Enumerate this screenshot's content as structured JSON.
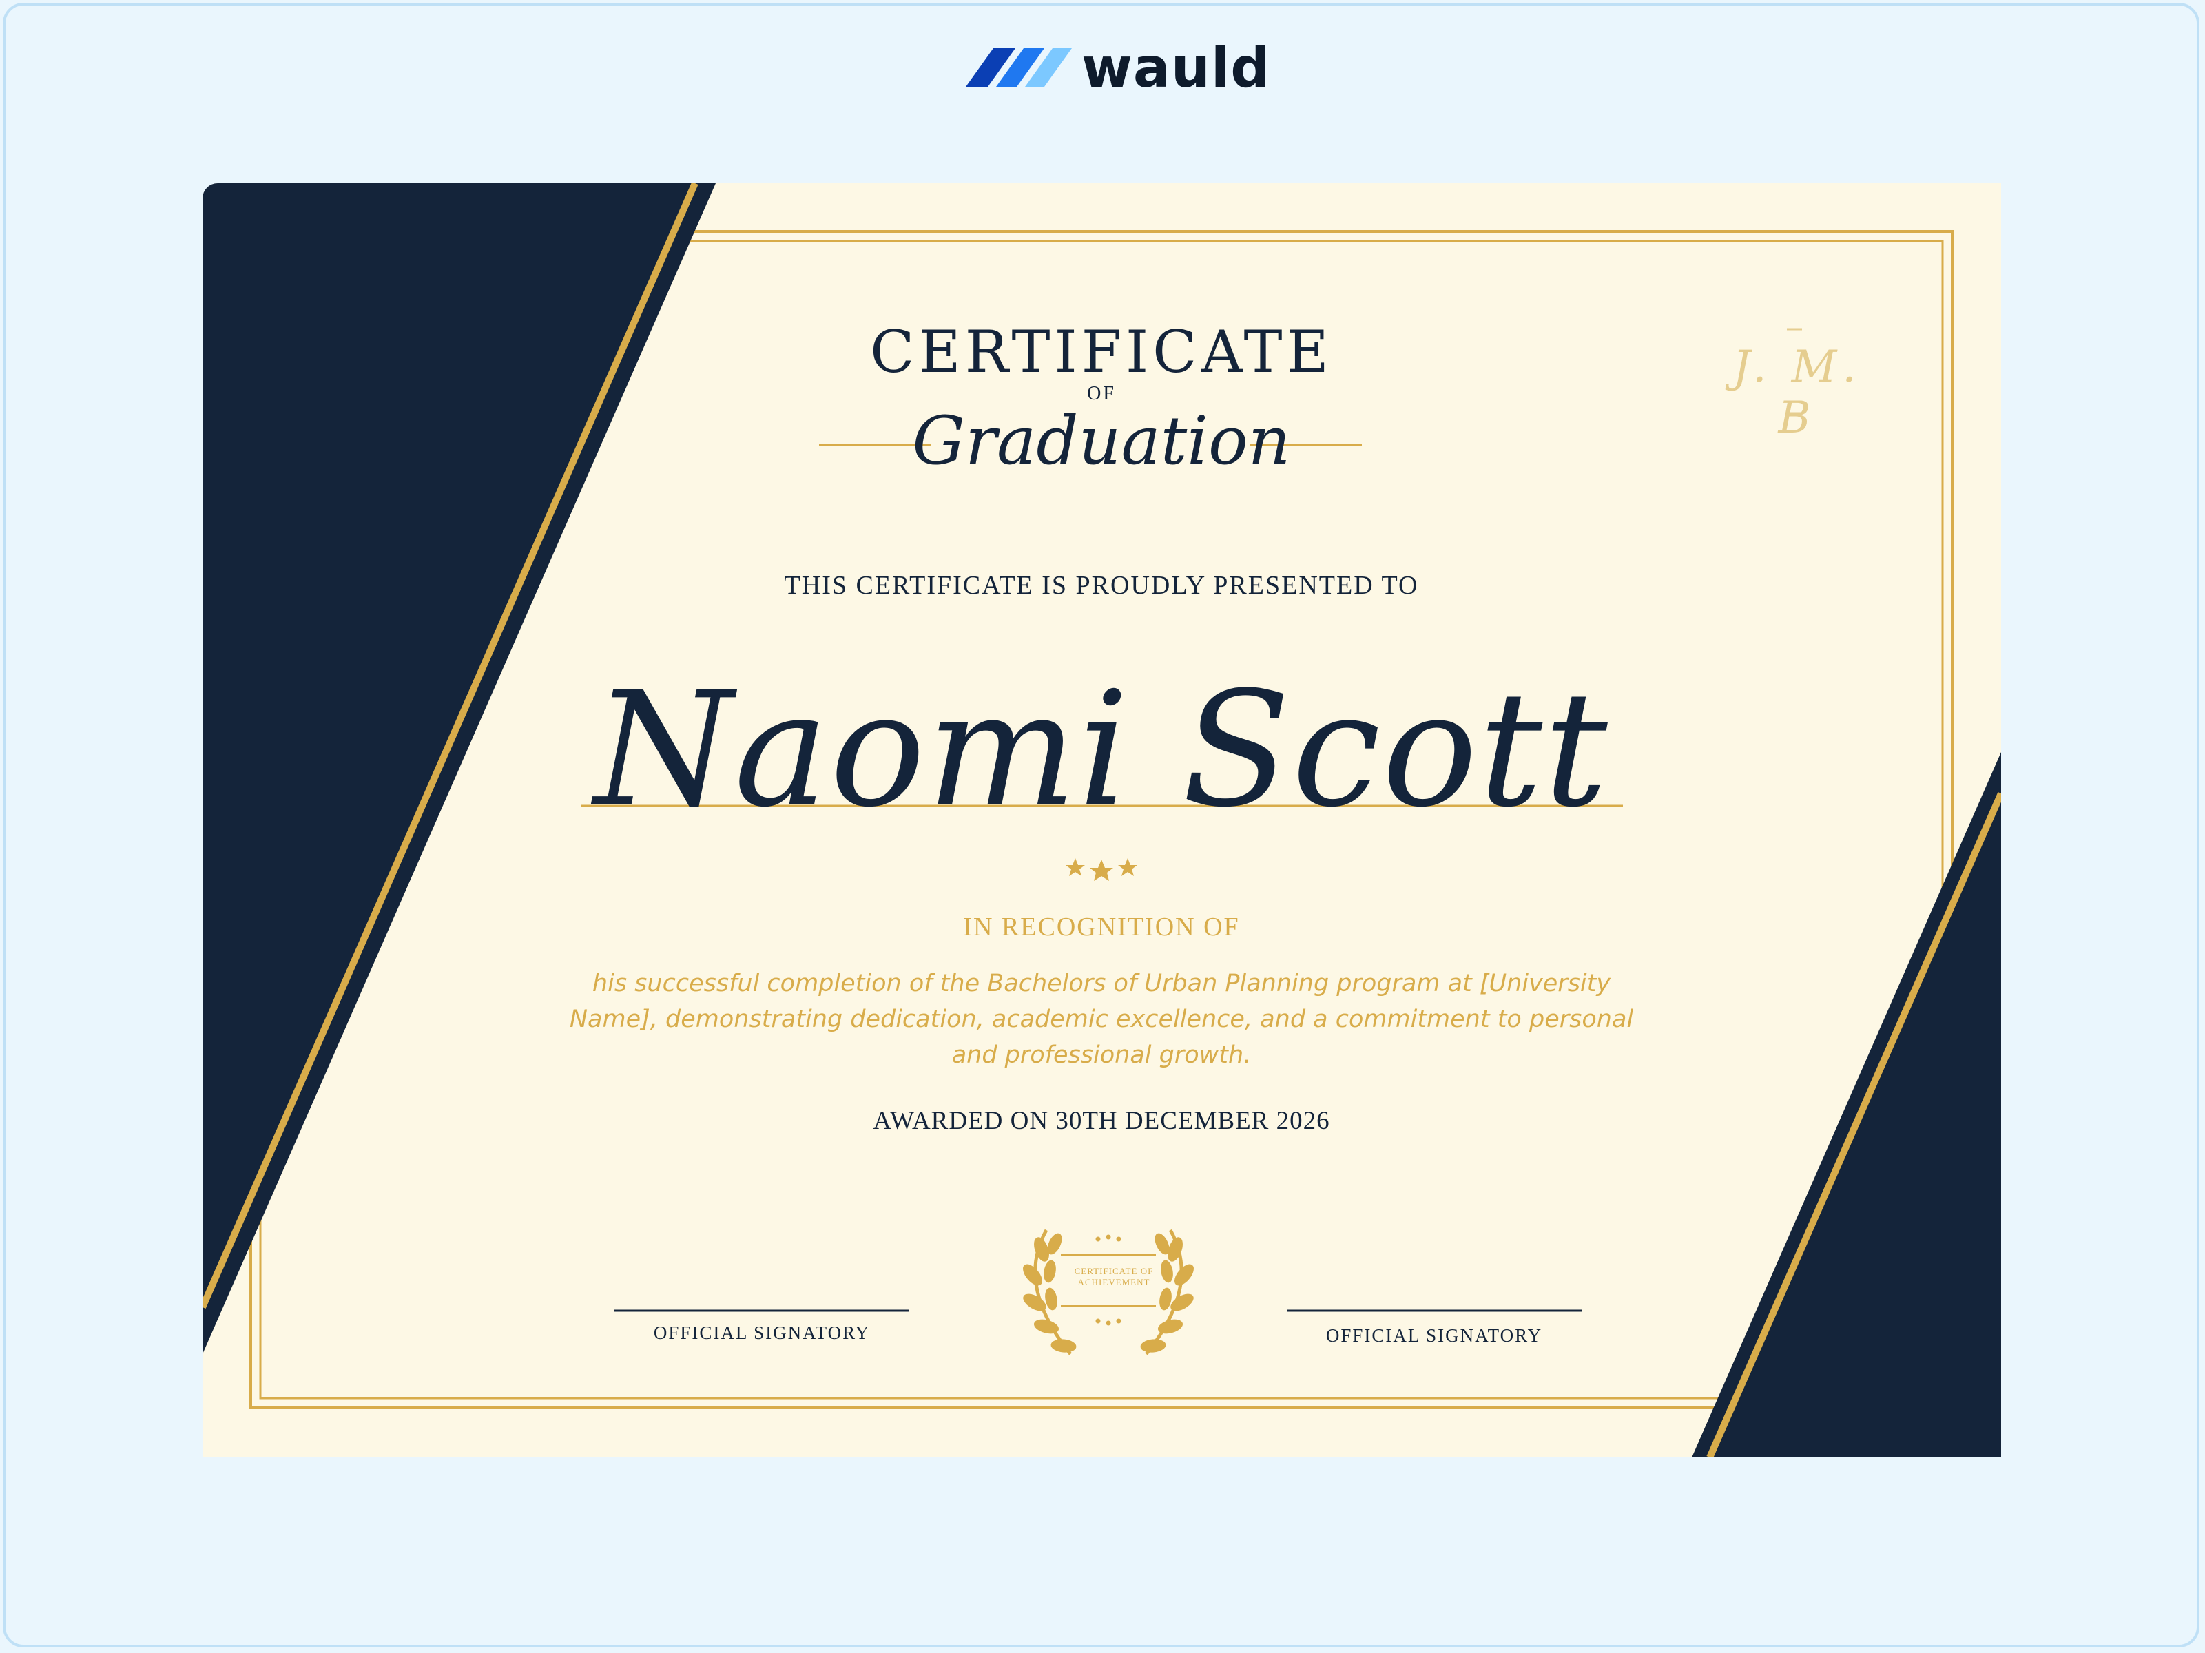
{
  "brand": {
    "name": "wauld",
    "colors": {
      "mark_dark": "#0b3fb4",
      "mark_mid": "#1f78f0",
      "mark_light": "#7cc8ff"
    }
  },
  "certificate": {
    "title": "CERTIFICATE",
    "of": "OF",
    "subtitle": "Graduation",
    "monogram": "J. M. B",
    "presented_to": "THIS CERTIFICATE IS PROUDLY PRESENTED TO",
    "recipient": "Naomi Scott",
    "stars_icon": "three-stars-icon",
    "recognition_heading": "IN RECOGNITION OF",
    "recognition_text": "his successful completion of the Bachelors of Urban Planning program at [University Name], demonstrating dedication, academic excellence, and a commitment to personal and professional growth.",
    "awarded": "AWARDED ON 30TH DECEMBER 2026",
    "seal_text": "CERTIFICATE OF ACHIEVEMENT",
    "signatory_left": "OFFICIAL SIGNATORY",
    "signatory_right": "OFFICIAL SIGNATORY",
    "colors": {
      "navy": "#14243a",
      "gold": "#d8ac4a",
      "paper": "#fdf8e5"
    }
  }
}
